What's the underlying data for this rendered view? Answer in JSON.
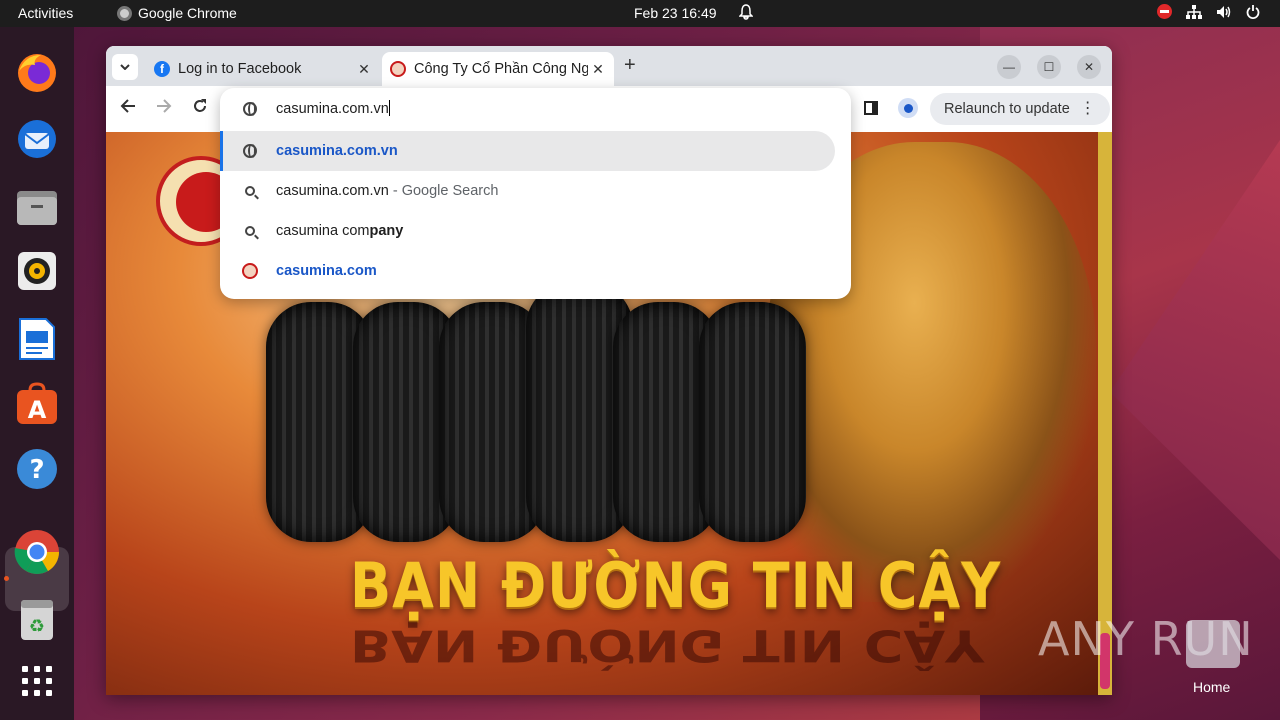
{
  "topbar": {
    "activities": "Activities",
    "app_name": "Google Chrome",
    "clock": "Feb 23  16:49"
  },
  "dock": {
    "items": [
      "firefox-icon",
      "thunderbird-icon",
      "files-icon",
      "rhythmbox-icon",
      "writer-icon",
      "app-center-icon",
      "help-icon",
      "chrome-icon",
      "trash-icon",
      "app-grid-icon"
    ]
  },
  "browser": {
    "tabs": [
      {
        "title": "Log in to Facebook",
        "favicon_color": "#1877f2"
      },
      {
        "title": "Công Ty Cổ Phần Công Nghiệp Cao Su Miền Nam",
        "favicon_color": "#c81b1b"
      }
    ],
    "relaunch_label": "Relaunch to update",
    "omnibox": {
      "input_value": "casumina.com.vn",
      "suggestions": [
        {
          "kind": "url",
          "text": "casumina.com.vn",
          "icon": "globe-icon"
        },
        {
          "kind": "search",
          "text": "casumina.com.vn",
          "suffix": " - Google Search",
          "icon": "search-icon"
        },
        {
          "kind": "search",
          "prefix": "casumina com",
          "bold": "pany",
          "icon": "search-icon"
        },
        {
          "kind": "url",
          "text": "casumina.com",
          "icon": "casumina-favicon"
        }
      ]
    }
  },
  "page": {
    "slogan": "BẠN ĐƯỜNG TIN CẬY"
  },
  "desktop": {
    "watermark": "ANY RUN",
    "home_label": "Home"
  }
}
